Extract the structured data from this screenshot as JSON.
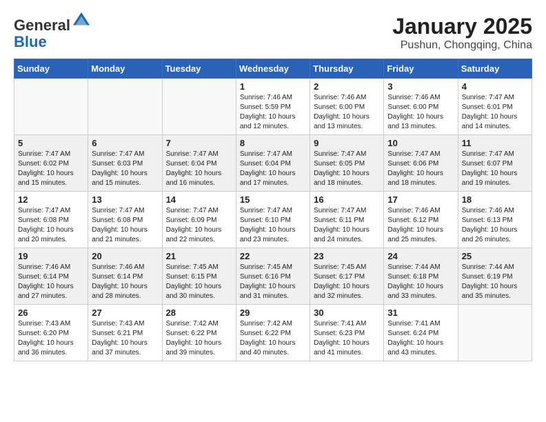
{
  "header": {
    "logo_general": "General",
    "logo_blue": "Blue",
    "main_title": "January 2025",
    "subtitle": "Pushun, Chongqing, China"
  },
  "weekdays": [
    "Sunday",
    "Monday",
    "Tuesday",
    "Wednesday",
    "Thursday",
    "Friday",
    "Saturday"
  ],
  "weeks": [
    [
      {
        "day": "",
        "info": ""
      },
      {
        "day": "",
        "info": ""
      },
      {
        "day": "",
        "info": ""
      },
      {
        "day": "1",
        "info": "Sunrise: 7:46 AM\nSunset: 5:59 PM\nDaylight: 10 hours and 12 minutes."
      },
      {
        "day": "2",
        "info": "Sunrise: 7:46 AM\nSunset: 6:00 PM\nDaylight: 10 hours and 13 minutes."
      },
      {
        "day": "3",
        "info": "Sunrise: 7:46 AM\nSunset: 6:00 PM\nDaylight: 10 hours and 13 minutes."
      },
      {
        "day": "4",
        "info": "Sunrise: 7:47 AM\nSunset: 6:01 PM\nDaylight: 10 hours and 14 minutes."
      }
    ],
    [
      {
        "day": "5",
        "info": "Sunrise: 7:47 AM\nSunset: 6:02 PM\nDaylight: 10 hours and 15 minutes."
      },
      {
        "day": "6",
        "info": "Sunrise: 7:47 AM\nSunset: 6:03 PM\nDaylight: 10 hours and 15 minutes."
      },
      {
        "day": "7",
        "info": "Sunrise: 7:47 AM\nSunset: 6:04 PM\nDaylight: 10 hours and 16 minutes."
      },
      {
        "day": "8",
        "info": "Sunrise: 7:47 AM\nSunset: 6:04 PM\nDaylight: 10 hours and 17 minutes."
      },
      {
        "day": "9",
        "info": "Sunrise: 7:47 AM\nSunset: 6:05 PM\nDaylight: 10 hours and 18 minutes."
      },
      {
        "day": "10",
        "info": "Sunrise: 7:47 AM\nSunset: 6:06 PM\nDaylight: 10 hours and 18 minutes."
      },
      {
        "day": "11",
        "info": "Sunrise: 7:47 AM\nSunset: 6:07 PM\nDaylight: 10 hours and 19 minutes."
      }
    ],
    [
      {
        "day": "12",
        "info": "Sunrise: 7:47 AM\nSunset: 6:08 PM\nDaylight: 10 hours and 20 minutes."
      },
      {
        "day": "13",
        "info": "Sunrise: 7:47 AM\nSunset: 6:08 PM\nDaylight: 10 hours and 21 minutes."
      },
      {
        "day": "14",
        "info": "Sunrise: 7:47 AM\nSunset: 6:09 PM\nDaylight: 10 hours and 22 minutes."
      },
      {
        "day": "15",
        "info": "Sunrise: 7:47 AM\nSunset: 6:10 PM\nDaylight: 10 hours and 23 minutes."
      },
      {
        "day": "16",
        "info": "Sunrise: 7:47 AM\nSunset: 6:11 PM\nDaylight: 10 hours and 24 minutes."
      },
      {
        "day": "17",
        "info": "Sunrise: 7:46 AM\nSunset: 6:12 PM\nDaylight: 10 hours and 25 minutes."
      },
      {
        "day": "18",
        "info": "Sunrise: 7:46 AM\nSunset: 6:13 PM\nDaylight: 10 hours and 26 minutes."
      }
    ],
    [
      {
        "day": "19",
        "info": "Sunrise: 7:46 AM\nSunset: 6:14 PM\nDaylight: 10 hours and 27 minutes."
      },
      {
        "day": "20",
        "info": "Sunrise: 7:46 AM\nSunset: 6:14 PM\nDaylight: 10 hours and 28 minutes."
      },
      {
        "day": "21",
        "info": "Sunrise: 7:45 AM\nSunset: 6:15 PM\nDaylight: 10 hours and 30 minutes."
      },
      {
        "day": "22",
        "info": "Sunrise: 7:45 AM\nSunset: 6:16 PM\nDaylight: 10 hours and 31 minutes."
      },
      {
        "day": "23",
        "info": "Sunrise: 7:45 AM\nSunset: 6:17 PM\nDaylight: 10 hours and 32 minutes."
      },
      {
        "day": "24",
        "info": "Sunrise: 7:44 AM\nSunset: 6:18 PM\nDaylight: 10 hours and 33 minutes."
      },
      {
        "day": "25",
        "info": "Sunrise: 7:44 AM\nSunset: 6:19 PM\nDaylight: 10 hours and 35 minutes."
      }
    ],
    [
      {
        "day": "26",
        "info": "Sunrise: 7:43 AM\nSunset: 6:20 PM\nDaylight: 10 hours and 36 minutes."
      },
      {
        "day": "27",
        "info": "Sunrise: 7:43 AM\nSunset: 6:21 PM\nDaylight: 10 hours and 37 minutes."
      },
      {
        "day": "28",
        "info": "Sunrise: 7:42 AM\nSunset: 6:22 PM\nDaylight: 10 hours and 39 minutes."
      },
      {
        "day": "29",
        "info": "Sunrise: 7:42 AM\nSunset: 6:22 PM\nDaylight: 10 hours and 40 minutes."
      },
      {
        "day": "30",
        "info": "Sunrise: 7:41 AM\nSunset: 6:23 PM\nDaylight: 10 hours and 41 minutes."
      },
      {
        "day": "31",
        "info": "Sunrise: 7:41 AM\nSunset: 6:24 PM\nDaylight: 10 hours and 43 minutes."
      },
      {
        "day": "",
        "info": ""
      }
    ]
  ]
}
